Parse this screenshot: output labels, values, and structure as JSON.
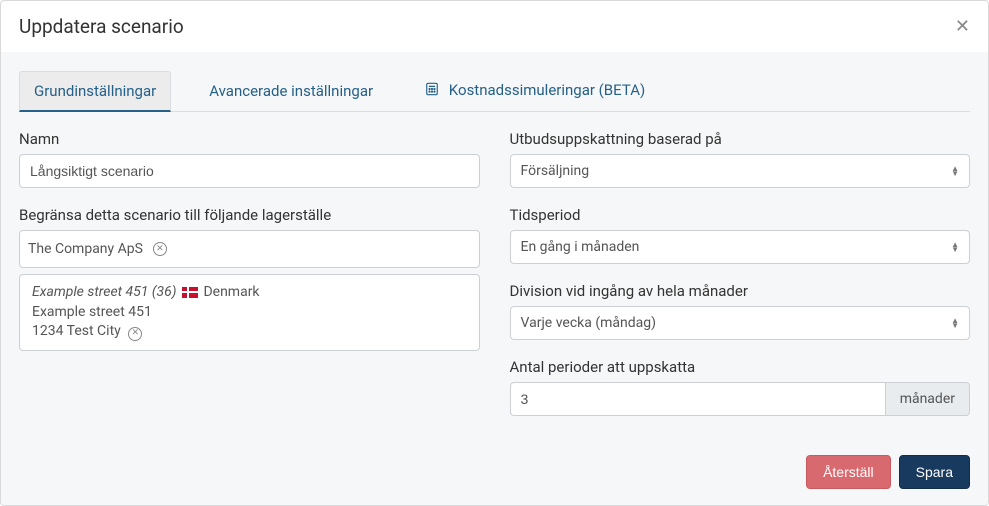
{
  "header": {
    "title": "Uppdatera scenario"
  },
  "tabs": {
    "basic": "Grundinställningar",
    "advanced": "Avancerade inställningar",
    "cost": "Kostnadssimuleringar (BETA)"
  },
  "left": {
    "name_label": "Namn",
    "name_value": "Långsiktigt scenario",
    "limit_label": "Begränsa detta scenario till följande lagerställe",
    "company_tag": "The Company ApS",
    "addr_title": "Example street 451 (36)",
    "addr_country": "Denmark",
    "addr_line1": "Example street 451",
    "addr_line2": "1234 Test City"
  },
  "right": {
    "supply_label": "Utbudsuppskattning baserad på",
    "supply_value": "Försäljning",
    "period_label": "Tidsperiod",
    "period_value": "En gång i månaden",
    "division_label": "Division vid ingång av hela månader",
    "division_value": "Varje vecka (måndag)",
    "num_label": "Antal perioder att uppskatta",
    "num_value": "3",
    "num_unit": "månader"
  },
  "footer": {
    "reset": "Återställ",
    "save": "Spara"
  }
}
